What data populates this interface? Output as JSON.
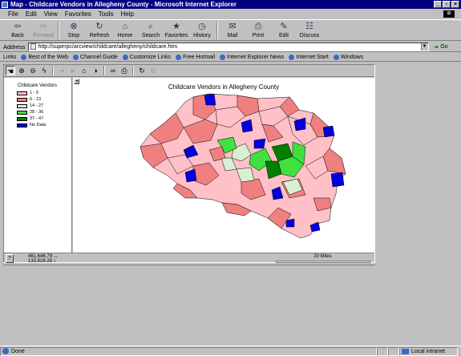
{
  "window": {
    "title": "Map - Childcare Vendors in Allegheny County - Microsoft Internet Explorer",
    "buttons": [
      "_",
      "▫",
      "×"
    ]
  },
  "menu": [
    "File",
    "Edit",
    "View",
    "Favorites",
    "Tools",
    "Help"
  ],
  "toolbar": [
    {
      "label": "Back",
      "icon": "back-arrow-icon",
      "glyph": "⇦",
      "enabled": true
    },
    {
      "label": "Forward",
      "icon": "forward-arrow-icon",
      "glyph": "⇨",
      "enabled": false
    },
    {
      "label": "Stop",
      "icon": "stop-icon",
      "glyph": "⊗",
      "enabled": true
    },
    {
      "label": "Refresh",
      "icon": "refresh-icon",
      "glyph": "↻",
      "enabled": true
    },
    {
      "label": "Home",
      "icon": "home-icon",
      "glyph": "⌂",
      "enabled": true
    },
    {
      "label": "Search",
      "icon": "search-icon",
      "glyph": "⌕",
      "enabled": true
    },
    {
      "label": "Favorites",
      "icon": "favorites-icon",
      "glyph": "★",
      "enabled": true
    },
    {
      "label": "History",
      "icon": "history-icon",
      "glyph": "◷",
      "enabled": true
    },
    {
      "label": "Mail",
      "icon": "mail-icon",
      "glyph": "✉",
      "enabled": true
    },
    {
      "label": "Print",
      "icon": "print-icon",
      "glyph": "⎙",
      "enabled": true
    },
    {
      "label": "Edit",
      "icon": "edit-icon",
      "glyph": "✎",
      "enabled": true
    },
    {
      "label": "Discuss",
      "icon": "discuss-icon",
      "glyph": "☷",
      "enabled": true
    }
  ],
  "address": {
    "label": "Address",
    "url": "http://superpc/arcview/childcare/allegheny/childcare.htm",
    "go": "Go"
  },
  "links": {
    "label": "Links",
    "items": [
      "Best of the Web",
      "Channel Guide",
      "Customize Links",
      "Free Hotmail",
      "Internet Explorer News",
      "Internet Start",
      "Windows"
    ]
  },
  "maptools": [
    {
      "name": "hand-pan-icon",
      "glyph": "☚",
      "enabled": true,
      "selected": true
    },
    {
      "name": "zoom-in-icon",
      "glyph": "⊕",
      "enabled": true
    },
    {
      "name": "zoom-out-icon",
      "glyph": "⊖",
      "enabled": true
    },
    {
      "name": "identify-icon",
      "glyph": "ϟ",
      "enabled": true
    },
    {
      "sep": true
    },
    {
      "name": "previous-extent-icon",
      "glyph": "◂",
      "enabled": false
    },
    {
      "name": "next-extent-icon",
      "glyph": "▸",
      "enabled": false
    },
    {
      "name": "full-extent-icon",
      "glyph": "⌂",
      "enabled": true
    },
    {
      "name": "globe-icon",
      "glyph": "◑",
      "enabled": true
    },
    {
      "sep": true
    },
    {
      "name": "binoculars-find-icon",
      "glyph": "∞",
      "enabled": true
    },
    {
      "name": "print-map-icon",
      "glyph": "⎙",
      "enabled": true
    },
    {
      "sep": true
    },
    {
      "name": "refresh-map-icon",
      "glyph": "↻",
      "enabled": true
    },
    {
      "name": "stop-map-icon",
      "glyph": "⊘",
      "enabled": false
    }
  ],
  "legend": {
    "title": "Childcare Vendors",
    "classes": [
      {
        "label": "1 - 5",
        "color": "#ffc0c8"
      },
      {
        "label": "6 - 13",
        "color": "#f08080"
      },
      {
        "label": "14 - 27",
        "color": "#d8f0d0"
      },
      {
        "label": "28 - 36",
        "color": "#40e040"
      },
      {
        "label": "37 - 47",
        "color": "#008000"
      },
      {
        "label": "No Data",
        "color": "#0000e0"
      }
    ]
  },
  "map": {
    "title": "Childcare Vendors in Allegheny County",
    "collapse": "◂"
  },
  "coords": {
    "x": "461,646.79",
    "y": "133,828.26",
    "x_arrow": "↔",
    "y_arrow": "↕"
  },
  "scale": {
    "label": "20 Miles"
  },
  "help": "?",
  "status": {
    "left": "Done",
    "zone": "Local intranet"
  }
}
